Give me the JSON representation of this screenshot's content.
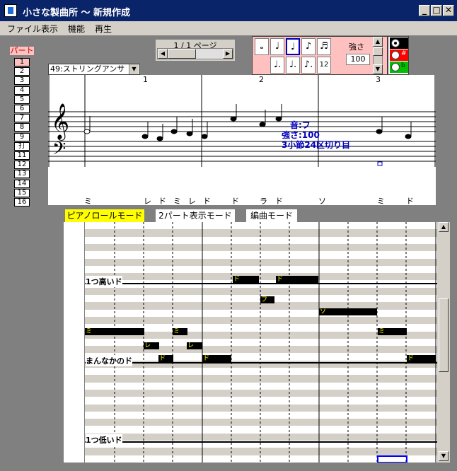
{
  "window": {
    "title": "小さな製曲所 ～ 新規作成"
  },
  "caption_buttons": {
    "minimize": "_",
    "maximize": "□",
    "close": "✕"
  },
  "menu": {
    "items": [
      "ファイル",
      "表示",
      "機能",
      "再生"
    ]
  },
  "parts": {
    "label": "パート",
    "items": [
      "1",
      "2",
      "3",
      "4",
      "5",
      "6",
      "7",
      "8",
      "9",
      "打",
      "11",
      "12",
      "13",
      "14",
      "15",
      "16"
    ],
    "selected": "1"
  },
  "page": {
    "label": "1 / 1 ページ"
  },
  "strength": {
    "label": "強さ",
    "value": "100"
  },
  "note_buttons": {
    "triplet_label": "12"
  },
  "accidentals": {
    "flat_label": "b",
    "sharp_label": "#"
  },
  "instrument": {
    "value": "49:ストリングアンサ"
  },
  "staff": {
    "measure_numbers": [
      "1",
      "2",
      "3"
    ],
    "note_names": [
      "ミ",
      "レ",
      "ド",
      "ミ",
      "レ",
      "ド",
      "ド",
      "ラ",
      "ド",
      "ソ",
      "ミ",
      "ド"
    ],
    "tooltip": {
      "line1": "音:フ",
      "line2": "強さ:100",
      "line3": "3小節24区切り目"
    }
  },
  "modes": {
    "piano_roll": "ピアノロールモード",
    "two_part": "2パート表示モード",
    "edit": "編曲モード"
  },
  "roll": {
    "label_high": "1つ高いド",
    "label_mid": "まんなかのド",
    "label_low": "1つ低いド",
    "note_chars": {
      "do": "ド",
      "re": "レ",
      "mi": "ミ",
      "fa": "フ",
      "so": "ソ"
    }
  },
  "colors": {
    "titlebar": "#0a246a",
    "selected_part": "#ffc0c0",
    "active_mode": "#ffff00",
    "note_label": "#ffff00",
    "tooltip": "#0000c0"
  }
}
